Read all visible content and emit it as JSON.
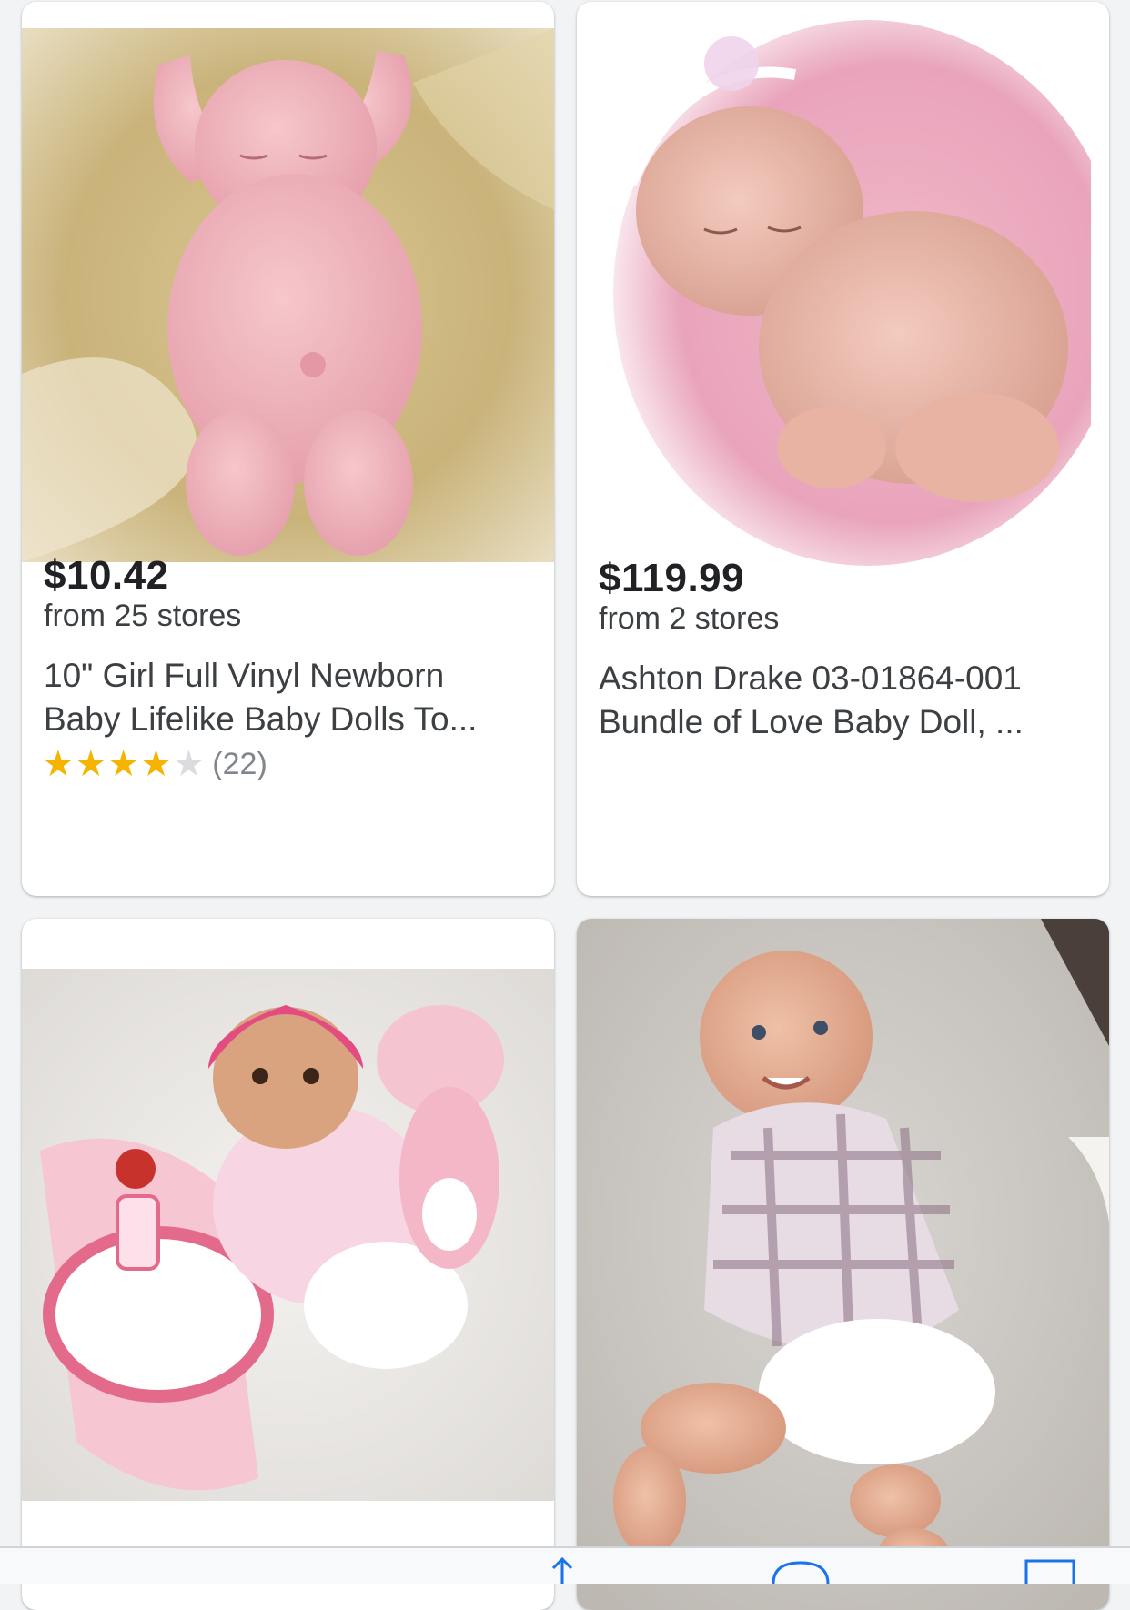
{
  "products": [
    {
      "price": "$10.42",
      "stores": "from 25 stores",
      "title_lines": [
        "10\" Girl Full Vinyl Newborn",
        "Baby Lifelike Baby Dolls To..."
      ],
      "rating": {
        "stars": 4,
        "max": 5,
        "count_label": "(22)"
      },
      "image": "doll-photo-sleeping-newborn-on-blanket"
    },
    {
      "price": "$119.99",
      "stores": "from 2 stores",
      "title_lines": [
        "Ashton Drake 03-01864-001",
        "Bundle of Love Baby Doll, ..."
      ],
      "image": "doll-photo-sleeping-baby-pink-headband"
    },
    {
      "image": "doll-photo-baby-with-giraffe-plush"
    },
    {
      "image": "doll-photo-smiling-baby-plaid-dress"
    }
  ],
  "toolbar": {
    "icons": [
      "share-icon",
      "bookmarks-icon",
      "tabs-icon"
    ]
  },
  "colors": {
    "star": "#f4b400",
    "star_empty": "#dadce0",
    "accent": "#1a73e8"
  }
}
